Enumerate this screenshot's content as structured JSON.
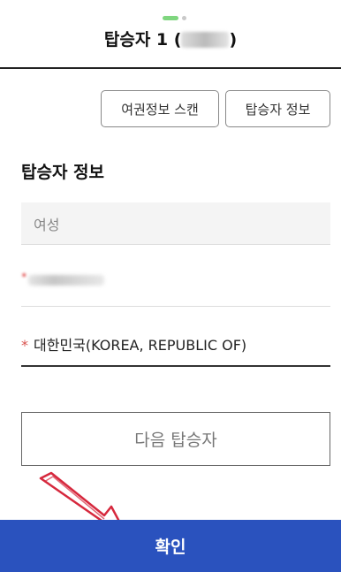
{
  "header": {
    "title_prefix": "탑승자 1 (",
    "title_suffix": ")"
  },
  "buttons": {
    "passport_scan": "여권정보 스캔",
    "passenger_info": "탑승자 정보",
    "next_passenger": "다음 탑승자",
    "confirm": "확인"
  },
  "section": {
    "title": "탑승자 정보"
  },
  "fields": {
    "gender_value": "여성",
    "nationality_required_mark": "*",
    "nationality_value": "대한민국(KOREA, REPUBLIC OF)"
  },
  "colors": {
    "primary": "#2a52be",
    "required": "#d9534f",
    "annotation": "#d6283d",
    "step_active": "#7fd67f"
  },
  "icons": {
    "annotation": "arrow-annotation-icon"
  }
}
